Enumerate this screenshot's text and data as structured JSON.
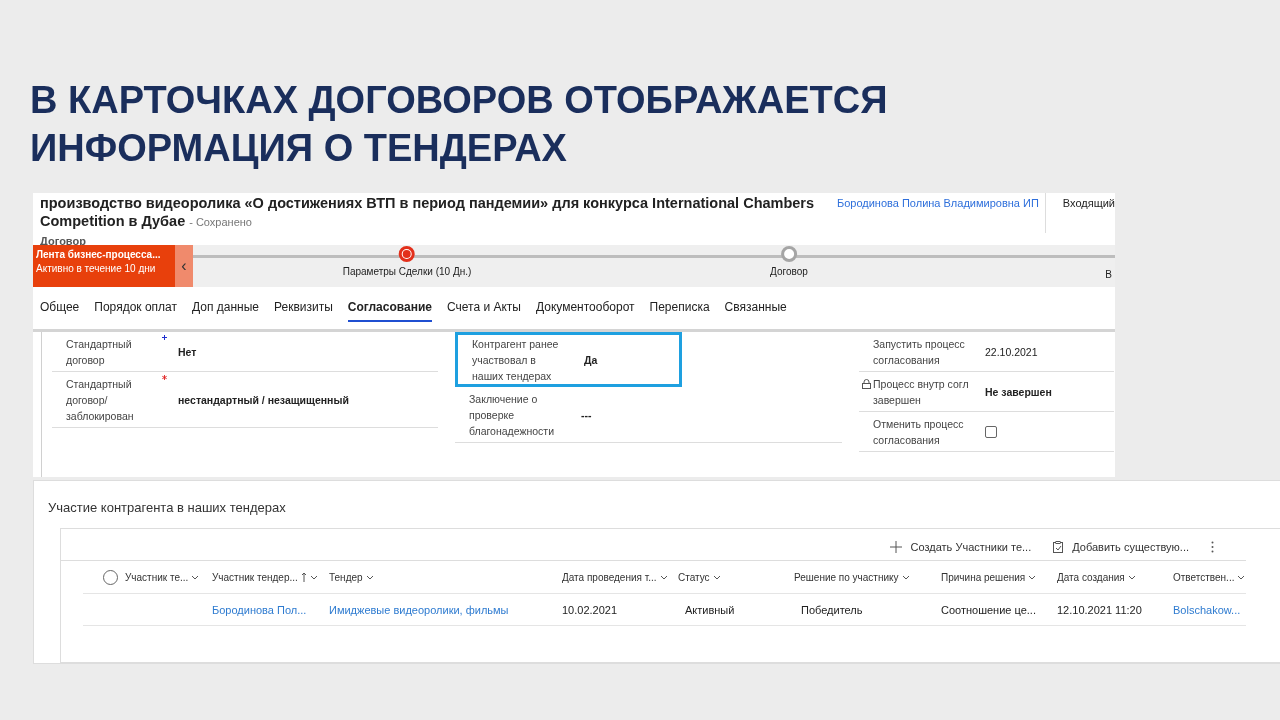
{
  "slide_title_lines": [
    "В КАРТОЧКАХ ДОГОВОРОВ ОТОБРАЖАЕТСЯ",
    "ИНФОРМАЦИЯ О ТЕНДЕРАХ"
  ],
  "record": {
    "title": "производство видеоролика «О достижениях ВТП в период пандемии» для конкурса International Chambers Competition в Дубае",
    "save_status": "- Сохранено",
    "entity": "Договор",
    "owner": "Бородинова Полина Владимировна ИП",
    "direction": "Входящий"
  },
  "process": {
    "name": "Лента бизнес-процесса...",
    "duration": "Активно в течение 10 дни",
    "collapse_glyph": "‹",
    "stages": [
      {
        "label": "Параметры Сделки  (10 Дн.)",
        "selected": true
      },
      {
        "label": "Договор",
        "selected": false
      }
    ],
    "next_stage_label": "В"
  },
  "tabs": [
    {
      "label": "Общее",
      "selected": false
    },
    {
      "label": "Порядок оплат",
      "selected": false
    },
    {
      "label": "Доп данные",
      "selected": false
    },
    {
      "label": "Реквизиты",
      "selected": false
    },
    {
      "label": "Согласование",
      "selected": true
    },
    {
      "label": "Счета и Акты",
      "selected": false
    },
    {
      "label": "Документооборот",
      "selected": false
    },
    {
      "label": "Переписка",
      "selected": false
    },
    {
      "label": "Связанные",
      "selected": false
    }
  ],
  "field_columns": [
    [
      {
        "label": "Стандартный договор",
        "kind": "text",
        "value": "Нет",
        "bold": true,
        "required": false,
        "recommended": true,
        "highlighted": false,
        "locked": false
      },
      {
        "label": "Стандартный договор/ заблокирован",
        "kind": "text",
        "value": "нестандартный / незащищенный",
        "bold": true,
        "required": true,
        "recommended": false,
        "highlighted": false,
        "locked": false
      }
    ],
    [
      {
        "label": "Контрагент ранее участвовал в наших тендерах",
        "kind": "text",
        "value": "Да",
        "bold": true,
        "required": false,
        "recommended": false,
        "highlighted": true,
        "locked": false
      },
      {
        "label": "Заключение о проверке благонадежности",
        "kind": "text",
        "value": "---",
        "bold": true,
        "required": false,
        "recommended": false,
        "highlighted": false,
        "locked": false
      }
    ],
    [
      {
        "label": "Запустить процесс согласования",
        "kind": "text",
        "value": "22.10.2021",
        "bold": false,
        "required": false,
        "recommended": false,
        "highlighted": false,
        "locked": false
      },
      {
        "label": "Процесс внутр согл завершен",
        "kind": "text",
        "value": "Не завершен",
        "bold": true,
        "required": false,
        "recommended": false,
        "highlighted": false,
        "locked": true
      },
      {
        "label": "Отменить процесс согласования",
        "kind": "checkbox",
        "checked": false,
        "required": false,
        "recommended": false,
        "highlighted": false,
        "locked": false
      }
    ]
  ],
  "subgrid": {
    "title": "Участие контрагента в наших тендерах",
    "commands": [
      {
        "label": "Создать Участники те...",
        "kind": "new"
      },
      {
        "label": "Добавить существую...",
        "kind": "add"
      }
    ],
    "select_all_checked": false,
    "columns": [
      {
        "label": "Участник те...",
        "sorted": false
      },
      {
        "label": "Участник тендер...",
        "sorted": true
      },
      {
        "label": "Тендер",
        "sorted": false
      },
      {
        "label": "Дата проведения т...",
        "sorted": false
      },
      {
        "label": "Статус",
        "sorted": false
      },
      {
        "label": "Решение по участнику",
        "sorted": false
      },
      {
        "label": "Причина решения",
        "sorted": false
      },
      {
        "label": "Дата создания",
        "sorted": false
      },
      {
        "label": "Ответствен...",
        "sorted": false
      }
    ],
    "rows": [
      {
        "selected": false,
        "cells": [
          {
            "text": ""
          },
          {
            "text": "Бородинова Пол...",
            "link": true
          },
          {
            "text": "Имиджевые видеоролики, фильмы",
            "link": true
          },
          {
            "text": "10.02.2021",
            "link": false
          },
          {
            "text": "Активный",
            "link": false
          },
          {
            "text": "Победитель",
            "link": false
          },
          {
            "text": "Соотношение це...",
            "link": false
          },
          {
            "text": "12.10.2021 11:20",
            "link": false
          },
          {
            "text": "Bolschakow...",
            "link": true
          }
        ]
      }
    ]
  }
}
